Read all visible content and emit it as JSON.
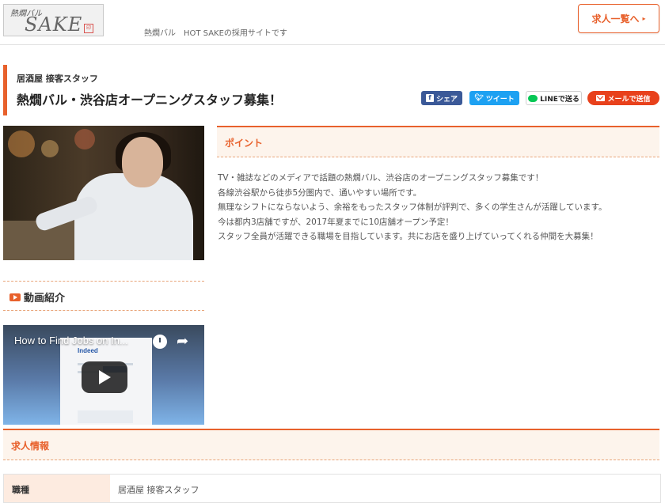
{
  "header": {
    "logo_line1": "熱燗バル",
    "logo_line2": "SAKE",
    "logo_seal": "印",
    "tagline": "熱燗バル　HOT SAKEの採用サイトです",
    "list_button": "求人一覧へ",
    "list_button_arrow": "▸"
  },
  "job": {
    "category": "居酒屋 接客スタッフ",
    "title": "熱燗バル・渋谷店オープニングスタッフ募集！"
  },
  "share": {
    "facebook": "シェア",
    "twitter": "ツイート",
    "line": "LINEで送る",
    "mail": "メールで送信"
  },
  "video": {
    "heading": "動画紹介",
    "title": "How to Find Jobs on In...",
    "brand": "Indeed"
  },
  "point": {
    "heading": "ポイント",
    "lines": [
      "TV・雑誌などのメディアで話題の熱燗バル、渋谷店のオープニングスタッフ募集です！",
      "各線渋谷駅から徒歩5分圏内で、通いやすい場所です。",
      "無理なシフトにならないよう、余裕をもったスタッフ体制が評判で、多くの学生さんが活躍しています。",
      "今は都内3店舗ですが、2017年夏までに10店舗オープン予定！",
      "スタッフ全員が活躍できる職場を目指しています。共にお店を盛り上げていってくれる仲間を大募集！"
    ]
  },
  "job_info": {
    "heading": "求人情報",
    "rows": [
      {
        "label": "職種",
        "value": "居酒屋 接客スタッフ"
      }
    ]
  },
  "colors": {
    "accent": "#e8612c",
    "facebook": "#3b5998",
    "twitter": "#1da1f2",
    "line": "#06c755",
    "mail": "#e8411c"
  }
}
